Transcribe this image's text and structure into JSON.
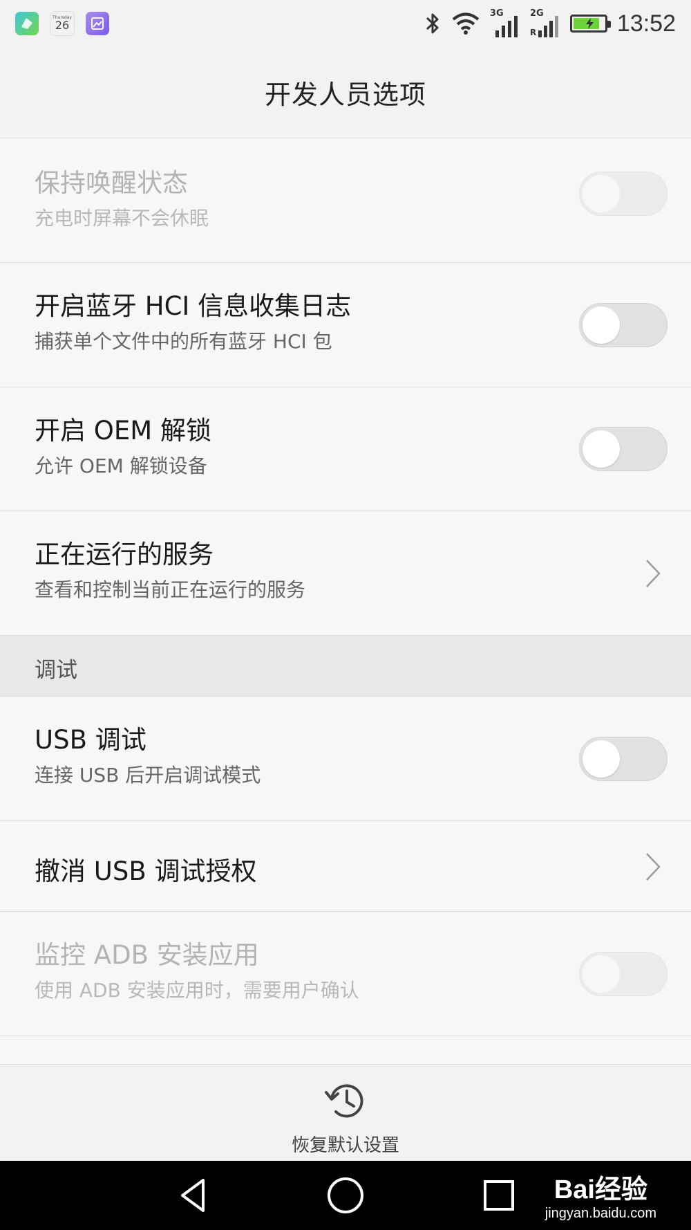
{
  "status_bar": {
    "time": "13:52",
    "calendar_day": "26",
    "calendar_weekday": "Thursday",
    "signal_1_label": "3G",
    "signal_2_label": "2G",
    "signal_2_roaming": "R",
    "battery_level": 0.85,
    "icons": [
      "maps-icon",
      "calendar-icon",
      "gallery-icon",
      "bluetooth-icon",
      "wifi-icon",
      "signal-icon",
      "signal-icon",
      "battery-icon"
    ]
  },
  "header": {
    "title": "开发人员选项"
  },
  "items": [
    {
      "title": "保持唤醒状态",
      "subtitle": "充电时屏幕不会休眠",
      "control": "toggle",
      "enabled": false,
      "on": false
    },
    {
      "title": "开启蓝牙 HCI 信息收集日志",
      "subtitle": "捕获单个文件中的所有蓝牙 HCI 包",
      "control": "toggle",
      "enabled": true,
      "on": false
    },
    {
      "title": "开启 OEM 解锁",
      "subtitle": "允许 OEM 解锁设备",
      "control": "toggle",
      "enabled": true,
      "on": false
    },
    {
      "title": "正在运行的服务",
      "subtitle": "查看和控制当前正在运行的服务",
      "control": "chevron",
      "enabled": true
    }
  ],
  "section": {
    "label": "调试"
  },
  "debug_items": [
    {
      "title": "USB 调试",
      "subtitle": "连接 USB 后开启调试模式",
      "control": "toggle",
      "enabled": true,
      "on": false
    },
    {
      "title": "撤消 USB 调试授权",
      "control": "chevron",
      "enabled": true
    },
    {
      "title": "监控 ADB 安装应用",
      "subtitle": "使用 ADB 安装应用时，需要用户确认",
      "control": "toggle",
      "enabled": false,
      "on": false
    }
  ],
  "bottom": {
    "restore_label": "恢复默认设置"
  },
  "watermark": {
    "brand": "Bai经验",
    "url": "jingyan.baidu.com"
  },
  "colors": {
    "background": "#f7f7f7",
    "section_bg": "#e8e8e8",
    "toggle_off": "#e1e1e1",
    "battery_fill": "#6cd43a",
    "nav_bar": "#000000"
  }
}
